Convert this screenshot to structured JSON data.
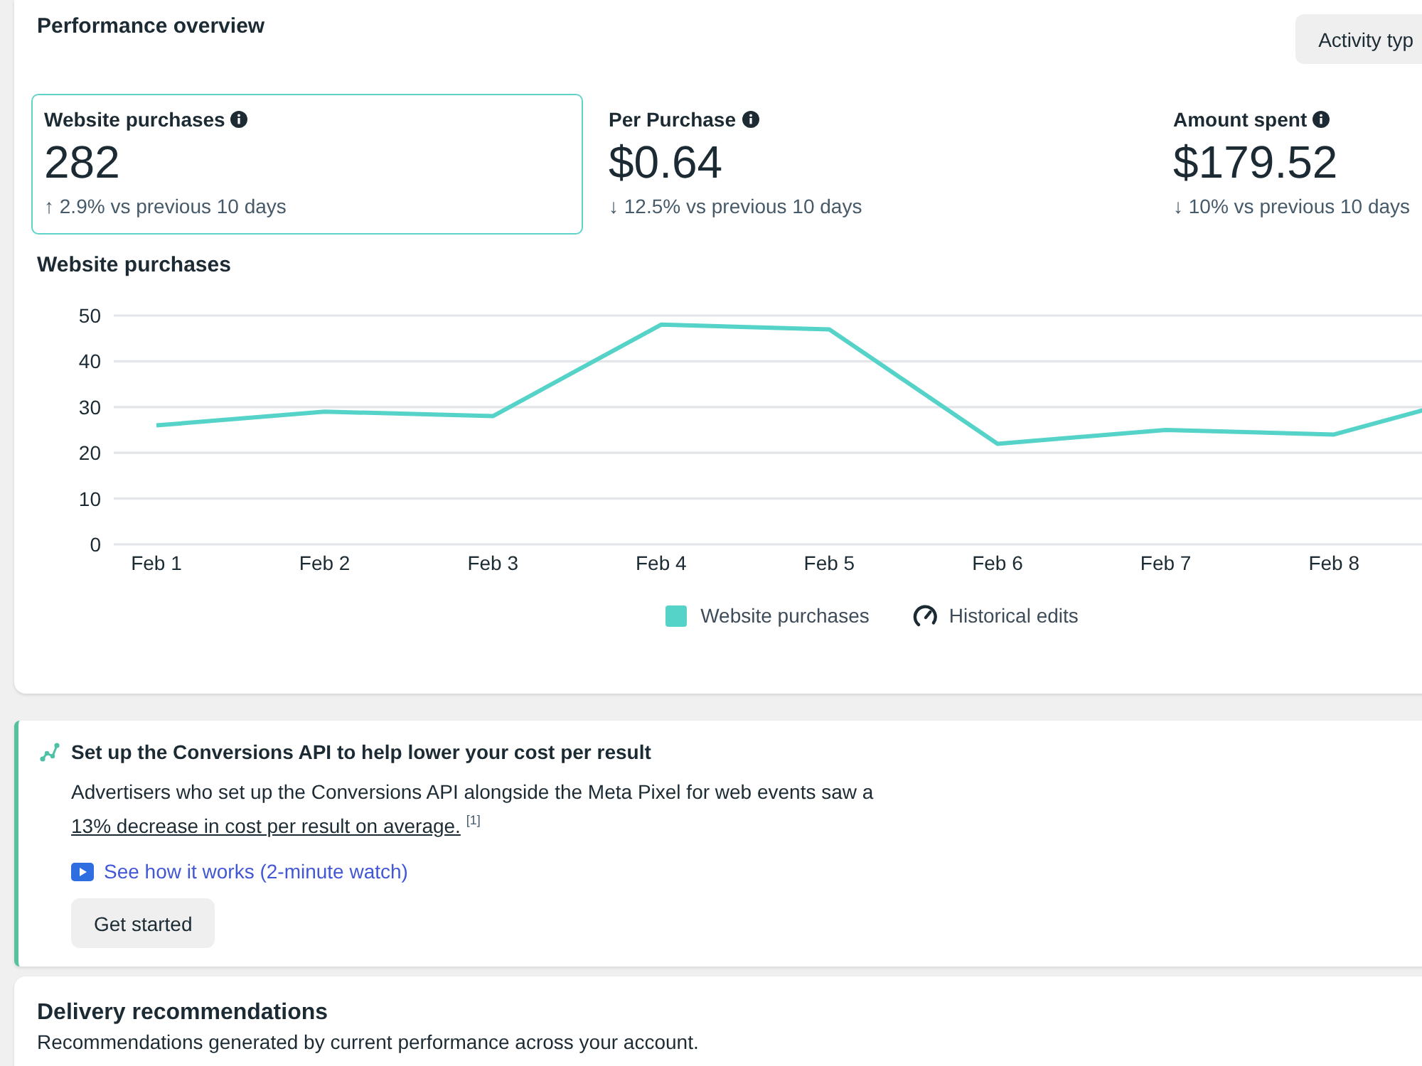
{
  "performance_overview": {
    "title": "Performance overview",
    "activity_button": "Activity typ",
    "metrics": [
      {
        "label": "Website purchases",
        "value": "282",
        "change": "↑ 2.9% vs previous 10 days",
        "selected": true
      },
      {
        "label": "Per Purchase",
        "value": "$0.64",
        "change": "↓ 12.5% vs previous 10 days",
        "selected": false
      },
      {
        "label": "Amount spent",
        "value": "$179.52",
        "change": "↓ 10% vs previous 10 days",
        "selected": false
      }
    ],
    "chart_data": {
      "type": "line",
      "title": "Website purchases",
      "categories": [
        "Feb 1",
        "Feb 2",
        "Feb 3",
        "Feb 4",
        "Feb 5",
        "Feb 6",
        "Feb 7",
        "Feb 8",
        null
      ],
      "series": [
        {
          "name": "Website purchases",
          "color": "#56d3c8",
          "values": [
            26,
            29,
            28,
            48,
            47,
            22,
            25,
            24,
            34
          ]
        }
      ],
      "ylim": [
        0,
        50
      ],
      "yticks": [
        0,
        10,
        20,
        30,
        40,
        50
      ],
      "grid": true,
      "legend": "bottom"
    },
    "historical_edits_legend": "Historical edits"
  },
  "conversions_api_tip": {
    "title": "Set up the Conversions API to help lower your cost per result",
    "body": "Advertisers who set up the Conversions API alongside the Meta Pixel for web events saw a",
    "link": "13% decrease in cost per result on average.",
    "footnote": "[1]",
    "video_link": "See how it works (2-minute watch)",
    "button": "Get started"
  },
  "delivery_recommendations": {
    "title": "Delivery recommendations",
    "subtitle": "Recommendations generated by current performance across your account."
  }
}
